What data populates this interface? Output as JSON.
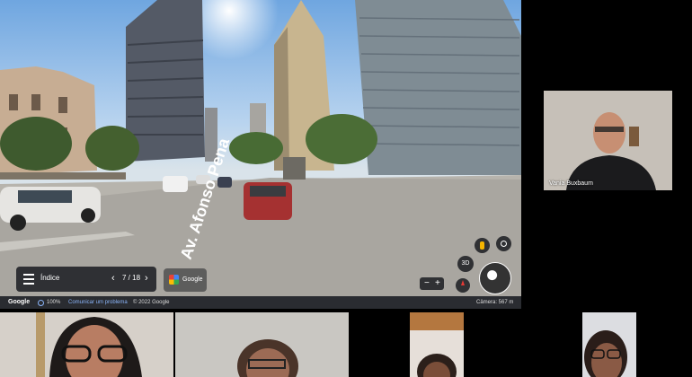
{
  "earth": {
    "street_label": "Av. Afonso Pena",
    "tour_title": "Índice",
    "tour_page": "7 / 18",
    "prev_symbol": "‹",
    "next_symbol": "›",
    "google_button": "Google",
    "btn_3d": "3D",
    "zoom_minus": "−",
    "zoom_plus": "+",
    "status": {
      "logo": "Google",
      "zoom": "100%",
      "link": "Comunicar um problema",
      "copyright": "© 2022 Google",
      "camera": "Câmera: 567 m"
    }
  },
  "participants": {
    "main_name": "Vania Buxbaum"
  },
  "colors": {
    "screen_bg": "#6fa6e0",
    "toolbar": "#1e2024",
    "accent": "#8ab4f8"
  }
}
